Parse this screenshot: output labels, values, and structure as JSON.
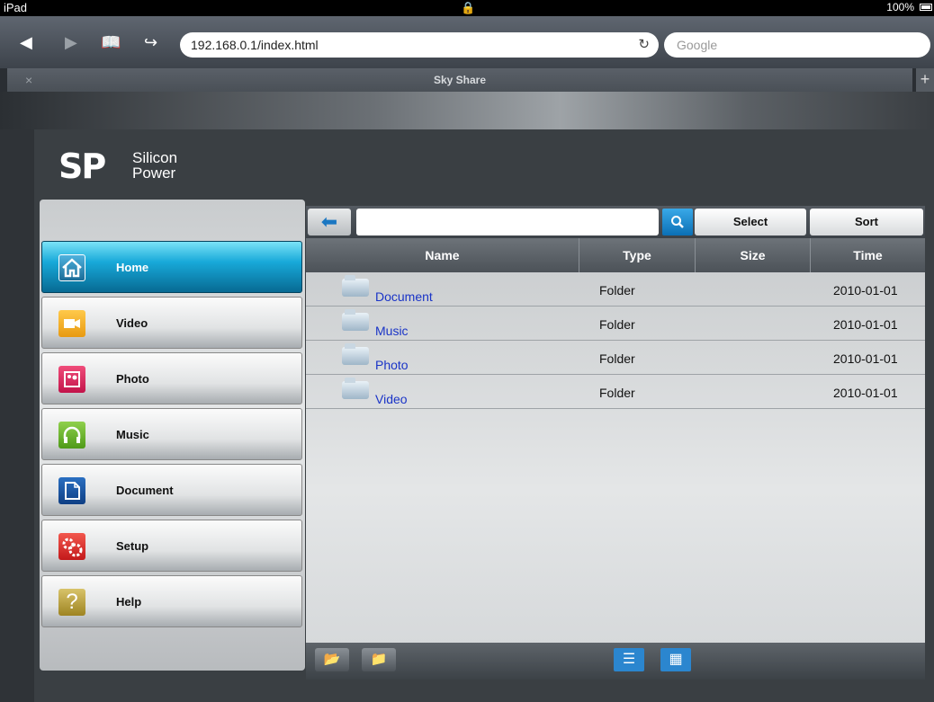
{
  "status_bar": {
    "device": "iPad",
    "battery": "100%"
  },
  "browser": {
    "url": "192.168.0.1/index.html",
    "search_placeholder": "Google",
    "tab_title": "Sky Share"
  },
  "logo": {
    "line1": "Silicon",
    "line2": "Power",
    "mark": "SP"
  },
  "sidebar": {
    "items": [
      {
        "label": "Home"
      },
      {
        "label": "Video"
      },
      {
        "label": "Photo"
      },
      {
        "label": "Music"
      },
      {
        "label": "Document"
      },
      {
        "label": "Setup"
      },
      {
        "label": "Help"
      }
    ]
  },
  "toolbar": {
    "select_label": "Select",
    "sort_label": "Sort",
    "search_value": ""
  },
  "table": {
    "headers": {
      "name": "Name",
      "type": "Type",
      "size": "Size",
      "time": "Time"
    },
    "rows": [
      {
        "name": "Document",
        "type": "Folder",
        "size": "",
        "time": "2010-01-01"
      },
      {
        "name": "Music",
        "type": "Folder",
        "size": "",
        "time": "2010-01-01"
      },
      {
        "name": "Photo",
        "type": "Folder",
        "size": "",
        "time": "2010-01-01"
      },
      {
        "name": "Video",
        "type": "Folder",
        "size": "",
        "time": "2010-01-01"
      }
    ]
  },
  "icons": {
    "home": "home-icon",
    "video": "video-icon",
    "photo": "photo-icon",
    "music": "headphones-icon",
    "document": "document-icon",
    "setup": "gears-icon",
    "help": "question-icon"
  },
  "colors": {
    "accent": "#18a9d9",
    "link": "#1a34c7"
  }
}
